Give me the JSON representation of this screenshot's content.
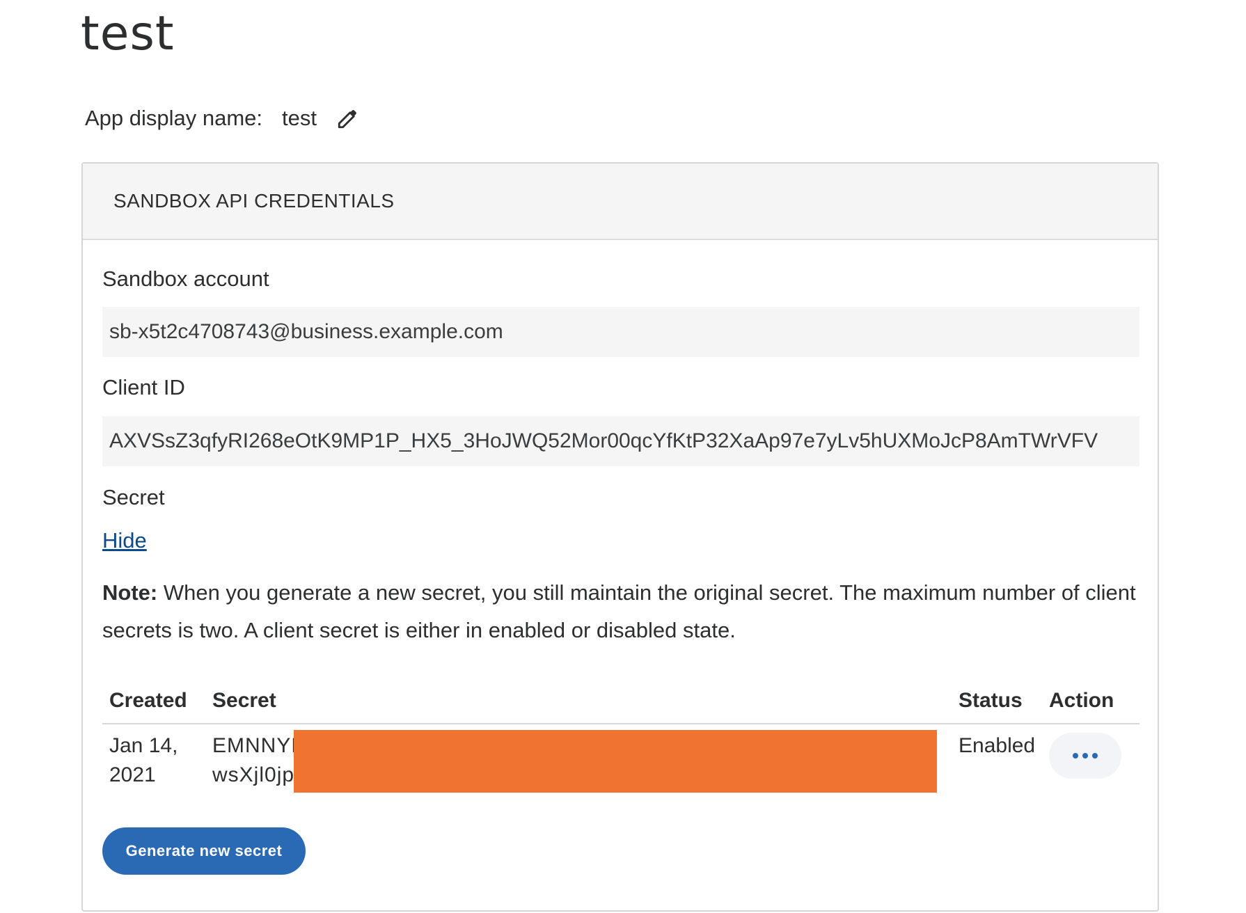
{
  "page": {
    "title": "test"
  },
  "app": {
    "display_name_label": "App display name:",
    "display_name_value": "test",
    "edit_icon": "pencil-icon"
  },
  "credentials": {
    "header": "SANDBOX API CREDENTIALS",
    "sandbox_account_label": "Sandbox account",
    "sandbox_account_value": "sb-x5t2c4708743@business.example.com",
    "client_id_label": "Client ID",
    "client_id_value": "AXVSsZ3qfyRI268eOtK9MP1P_HX5_3HoJWQ52Mor00qcYfKtP32XaAp97e7yLv5hUXMoJcP8AmTWrVFV",
    "secret_label": "Secret",
    "hide_link": "Hide",
    "note_bold": "Note:",
    "note_text": " When you generate a new secret, you still maintain the original secret. The maximum number of client secrets is two. A client secret is either in enabled or disabled state.",
    "table": {
      "headers": {
        "created": "Created",
        "secret": "Secret",
        "status": "Status",
        "action": "Action"
      },
      "rows": [
        {
          "created_line1": "Jan 14,",
          "created_line2": "2021",
          "secret_line1": "EMNNYK",
          "secret_line2": "wsXjl0jp",
          "status": "Enabled",
          "action_icon": "more-horizontal-icon"
        }
      ]
    },
    "generate_button": "Generate new secret",
    "colors": {
      "primary": "#2a69b4",
      "link": "#0c4a8c",
      "redaction": "#f07431"
    }
  }
}
